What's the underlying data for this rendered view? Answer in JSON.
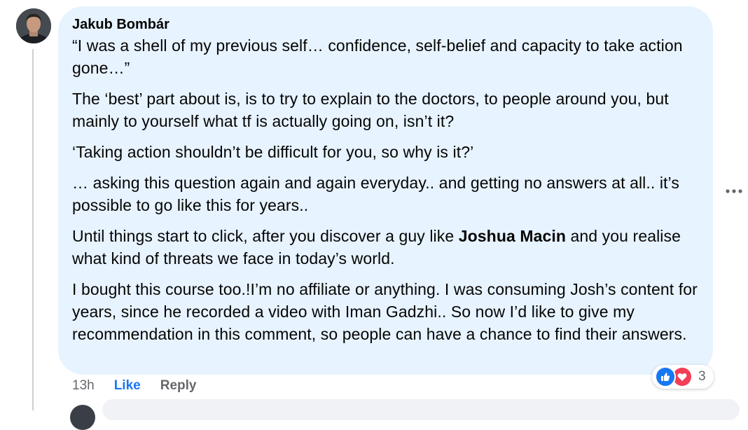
{
  "comment": {
    "author": "Jakub Bombár",
    "paragraphs": [
      {
        "text": "“I was a shell of my previous self… confidence, self-belief and capacity to take action gone…”"
      },
      {
        "text": "The ‘best’ part about is, is to try to explain to the doctors, to people around you, but mainly to yourself what tf is actually going on, isn’t it?"
      },
      {
        "text": "‘Taking action shouldn’t be difficult for you, so why is it?’"
      },
      {
        "text": "… asking this question again and again everyday.. and getting no answers at all.. it’s possible to go like this for years.."
      },
      {
        "before": "Until things start to click, after you discover a guy like ",
        "mention": "Joshua Macin",
        "after": " and you realise what kind of threats we face in today’s world."
      },
      {
        "text": "I bought this course too.!I’m no affiliate or anything. I was consuming Josh’s content for years, since he recorded a video with Iman Gadzhi.. So now I’d like to give my recommendation in this comment, so people can have a chance to find their answers."
      }
    ],
    "timestamp": "13h",
    "like_label": "Like",
    "reply_label": "Reply",
    "reaction_count": "3",
    "reaction_icons": [
      "like-icon",
      "love-icon"
    ],
    "more_icon": "more-options-icon"
  },
  "colors": {
    "bubble": "#e7f3ff",
    "like_blue": "#1877f2",
    "love_red": "#f33e58",
    "meta_gray": "#65676b"
  }
}
